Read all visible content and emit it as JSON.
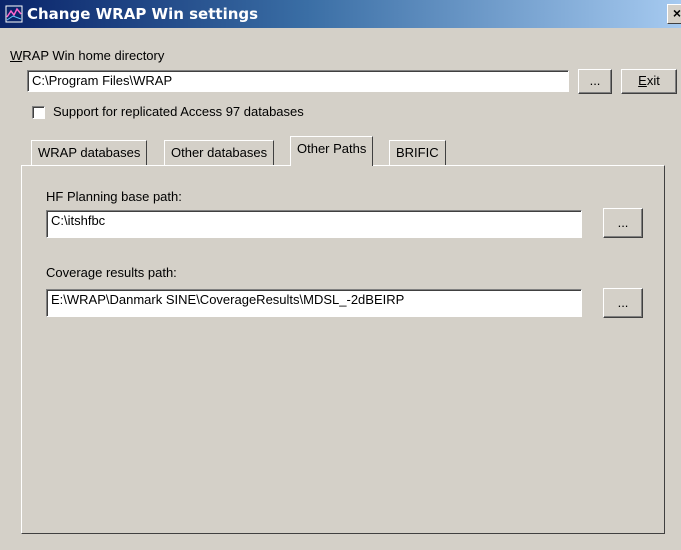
{
  "window": {
    "title": "Change WRAP Win settings",
    "close_label": "×"
  },
  "home": {
    "label_prefix": "W",
    "label_rest": "RAP Win home directory",
    "value": "C:\\Program Files\\WRAP",
    "browse_label": "...",
    "exit_underlined": "E",
    "exit_rest": "xit"
  },
  "replicated": {
    "label": "Support for replicated Access 97 databases",
    "checked": false
  },
  "tabs": [
    {
      "label": "WRAP databases",
      "active": false
    },
    {
      "label": "Other databases",
      "active": false
    },
    {
      "label": "Other Paths",
      "active": true
    },
    {
      "label": "BRIFIC",
      "active": false
    }
  ],
  "other_paths": {
    "hf_label": "HF Planning base path:",
    "hf_value": "C:\\itshfbc",
    "hf_browse": "...",
    "coverage_label": "Coverage results path:",
    "coverage_value": "E:\\WRAP\\Danmark SINE\\CoverageResults\\MDSL_-2dBEIRP",
    "coverage_browse": "..."
  },
  "colors": {
    "face": "#d4d0c8",
    "titlebar_start": "#0a246a",
    "titlebar_end": "#a6caf0"
  }
}
